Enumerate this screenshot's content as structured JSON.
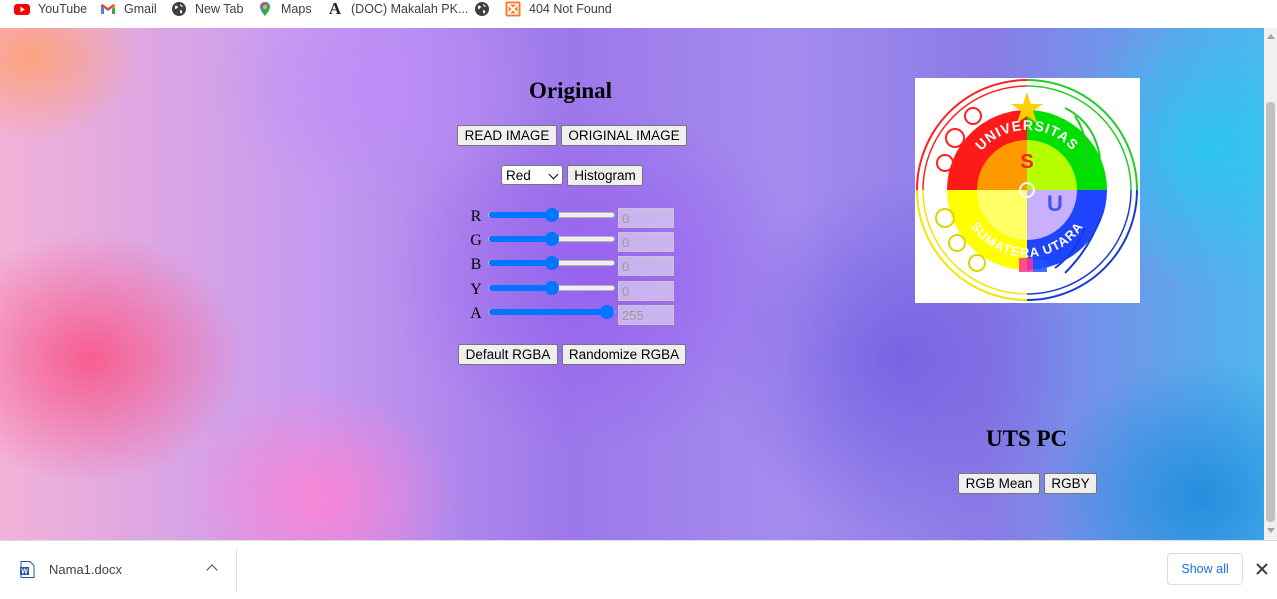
{
  "bookmarks": [
    {
      "label": "YouTube",
      "icon": "youtube-icon"
    },
    {
      "label": "Gmail",
      "icon": "gmail-icon"
    },
    {
      "label": "New Tab",
      "icon": "globe-icon"
    },
    {
      "label": "Maps",
      "icon": "maps-icon"
    },
    {
      "label": "(DOC) Makalah PK...",
      "icon": "academia-icon"
    },
    {
      "label": "",
      "icon": "globe-icon"
    },
    {
      "label": "404 Not Found",
      "icon": "xampp-icon"
    }
  ],
  "original": {
    "title": "Original",
    "read_image": "READ IMAGE",
    "original_image": "ORIGINAL IMAGE",
    "channel_select": "Red",
    "histogram": "Histogram",
    "sliders": [
      {
        "label": "R",
        "value": "0",
        "level": 0.5
      },
      {
        "label": "G",
        "value": "0",
        "level": 0.5
      },
      {
        "label": "B",
        "value": "0",
        "level": 0.5
      },
      {
        "label": "Y",
        "value": "0",
        "level": 0.5
      },
      {
        "label": "A",
        "value": "255",
        "level": 1.0
      }
    ],
    "default_rgba": "Default RGBA",
    "randomize_rgba": "Randomize RGBA"
  },
  "logo": {
    "top_text": "UNIVERSITAS",
    "bottom_text": "SUMATERA UTARA",
    "letters": [
      "S",
      "U"
    ]
  },
  "uts": {
    "title": "UTS PC",
    "rgb_mean": "RGB Mean",
    "rgby": "RGBY"
  },
  "download_bar": {
    "file_name": "Nama1.docx",
    "show_all": "Show all"
  },
  "colors": {
    "slider_accent": "#0075ff",
    "show_all_text": "#1a73e8"
  }
}
